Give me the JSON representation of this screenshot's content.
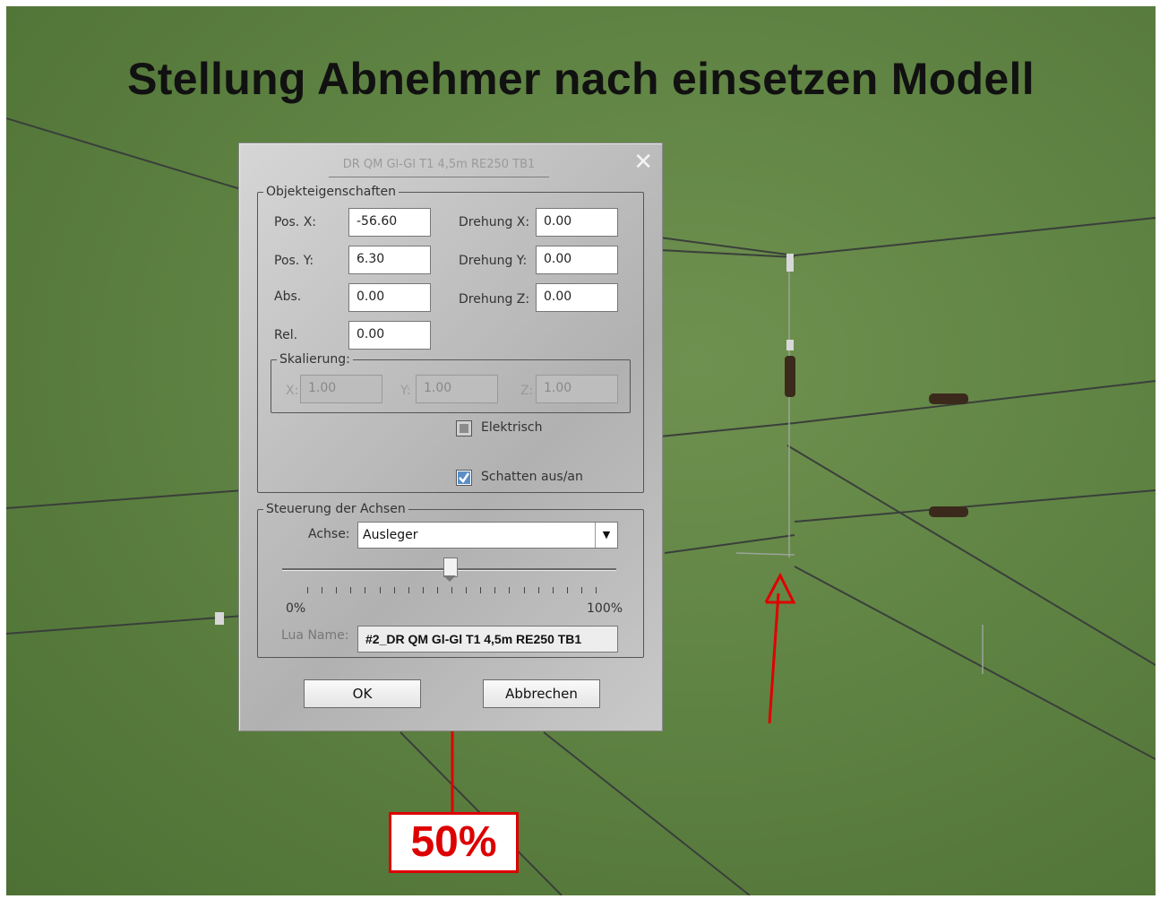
{
  "headline": "Stellung Abnehmer nach einsetzen Modell",
  "dialog": {
    "title": "DR QM Gl-Gl T1 4,5m RE250 TB1",
    "close_icon": "close-icon",
    "objekt": {
      "legend": "Objekteigenschaften",
      "pos_x_label": "Pos. X:",
      "pos_x_value": "-56.60",
      "pos_y_label": "Pos. Y:",
      "pos_y_value": "6.30",
      "abs_label": "Abs.",
      "abs_value": "0.00",
      "rel_label": "Rel.",
      "rel_value": "0.00",
      "drehung_x_label": "Drehung X:",
      "drehung_x_value": "0.00",
      "drehung_y_label": "Drehung Y:",
      "drehung_y_value": "0.00",
      "drehung_z_label": "Drehung Z:",
      "drehung_z_value": "0.00",
      "skalierung": {
        "legend": "Skalierung:",
        "x_label": "X:",
        "x_value": "1.00",
        "y_label": "Y:",
        "y_value": "1.00",
        "z_label": "Z:",
        "z_value": "1.00"
      },
      "elektrisch_label": "Elektrisch",
      "elektrisch_checked": false,
      "schatten_label": "Schatten aus/an",
      "schatten_checked": true
    },
    "achsen": {
      "legend": "Steuerung der Achsen",
      "achse_label": "Achse:",
      "achse_value": "Ausleger",
      "slider_value_percent": 50,
      "min_label": "0%",
      "max_label": "100%",
      "lua_label": "Lua Name:",
      "lua_value": "#2_DR QM Gl-Gl T1 4,5m RE250 TB1"
    },
    "ok_label": "OK",
    "cancel_label": "Abbrechen"
  },
  "callout": "50%",
  "colors": {
    "annotation": "#dd0000",
    "grass": "#5f8343"
  }
}
